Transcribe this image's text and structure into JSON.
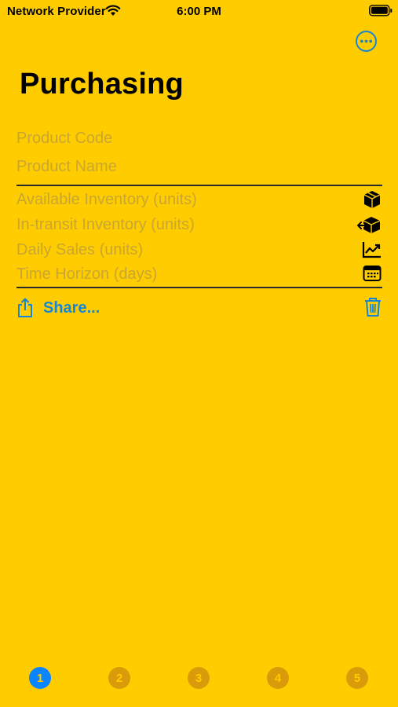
{
  "status_bar": {
    "carrier": "Network Provider",
    "time": "6:00 PM"
  },
  "header": {
    "title": "Purchasing"
  },
  "form": {
    "product_code_placeholder": "Product Code",
    "product_name_placeholder": "Product Name",
    "available_inventory_placeholder": "Available Inventory (units)",
    "in_transit_inventory_placeholder": "In-transit Inventory (units)",
    "daily_sales_placeholder": "Daily Sales (units)",
    "time_horizon_placeholder": "Time Horizon (days)"
  },
  "actions": {
    "share_label": "Share..."
  },
  "tabs": [
    {
      "label": "1",
      "active": true
    },
    {
      "label": "2",
      "active": false
    },
    {
      "label": "3",
      "active": false
    },
    {
      "label": "4",
      "active": false
    },
    {
      "label": "5",
      "active": false
    }
  ],
  "colors": {
    "background": "#FFCC00",
    "accent": "#1586D6",
    "tab_active": "#0A84FF",
    "tab_inactive": "#D99B0A",
    "placeholder": "#C9A632"
  },
  "icons": {
    "more": "ellipsis-circle-icon",
    "available_inventory": "cube-box-icon",
    "in_transit_inventory": "shipping-box-arrow-icon",
    "daily_sales": "chart-line-up-icon",
    "time_horizon": "calendar-icon",
    "share": "share-icon",
    "delete": "trash-icon"
  }
}
